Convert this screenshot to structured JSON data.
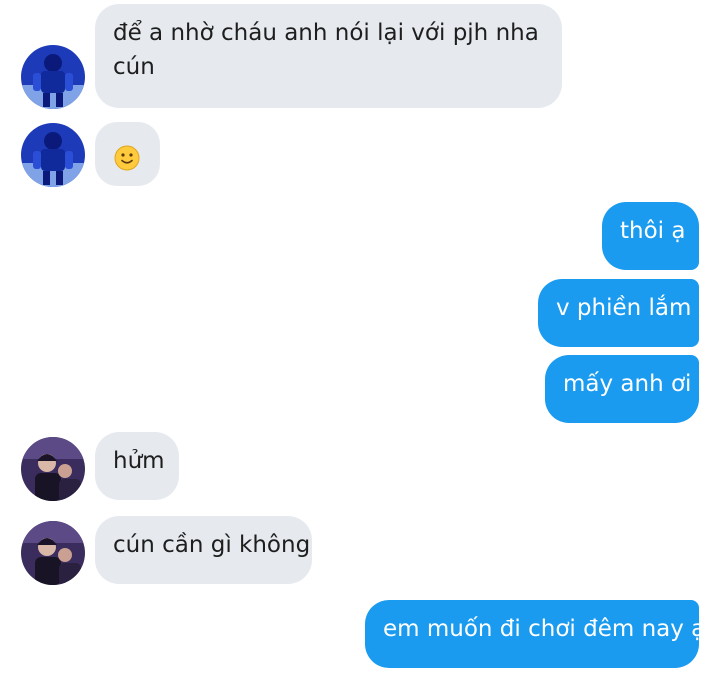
{
  "conversation": {
    "messages": [
      {
        "sender": "other",
        "avatar": "avatar-blue-figure",
        "line1": "để a nhờ cháu anh nói lại với pjh nha",
        "line2": "cún"
      },
      {
        "sender": "other",
        "avatar": "avatar-blue-figure",
        "emoji": "slightly-smiling-face-icon"
      },
      {
        "sender": "me",
        "text": "thôi ạ"
      },
      {
        "sender": "me",
        "text": "v phiền lắm"
      },
      {
        "sender": "me",
        "text": "mấy anh ơi"
      },
      {
        "sender": "other",
        "avatar": "avatar-dark-photo",
        "text": "hửm"
      },
      {
        "sender": "other",
        "avatar": "avatar-dark-photo",
        "text": "cún cần gì không"
      },
      {
        "sender": "me",
        "text": "em muốn đi chơi đêm nay ạ"
      }
    ]
  },
  "colors": {
    "incoming_bubble": "#e6eaef",
    "outgoing_bubble": "#1a9bf0",
    "incoming_text": "#1e1e1e",
    "outgoing_text": "#ffffff"
  }
}
